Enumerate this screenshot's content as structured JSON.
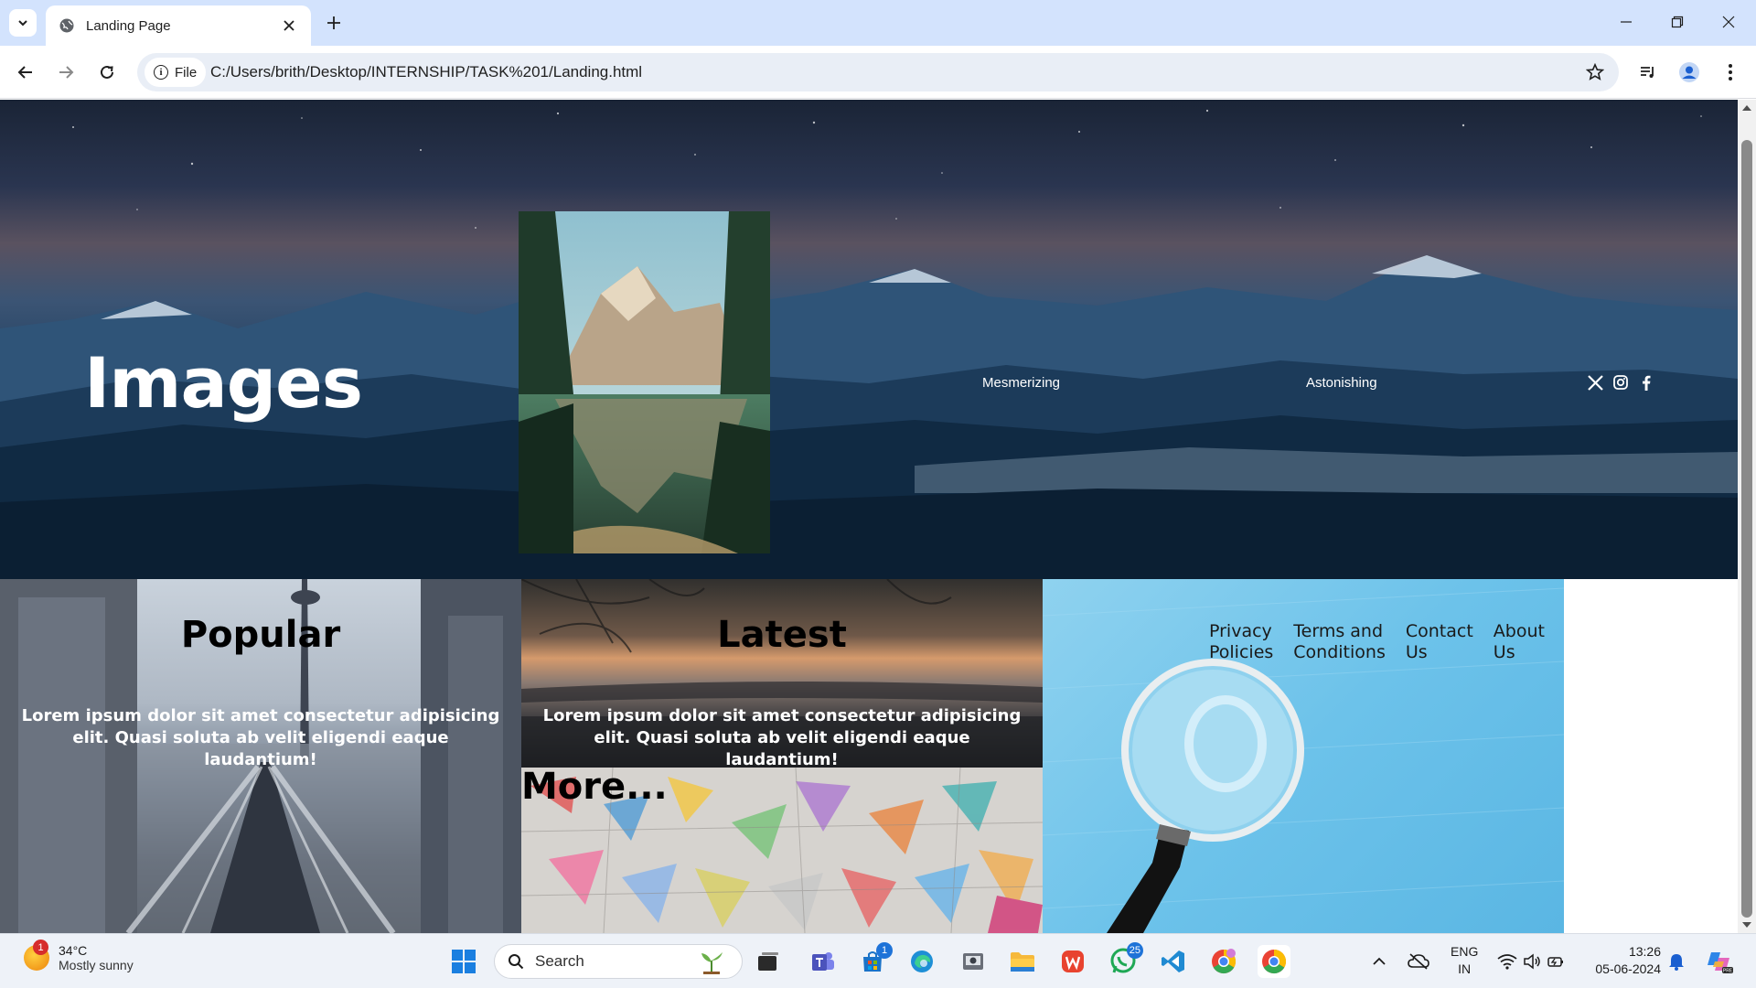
{
  "browser": {
    "tab_title": "Landing Page",
    "site_chip": "File",
    "url": "C:/Users/brith/Desktop/INTERNSHIP/TASK%201/Landing.html"
  },
  "hero": {
    "title": "Images",
    "links": [
      "Mesmerizing",
      "Astonishing"
    ],
    "social_icons": [
      "x-icon",
      "instagram-icon",
      "facebook-icon"
    ]
  },
  "cards": {
    "popular": {
      "title": "Popular",
      "text": "Lorem ipsum dolor sit amet consectetur adipisicing elit. Quasi soluta ab velit eligendi eaque laudantium!"
    },
    "latest": {
      "title": "Latest",
      "text": "Lorem ipsum dolor sit amet consectetur adipisicing elit. Quasi soluta ab velit eligendi eaque laudantium!"
    },
    "more": {
      "title": "More..."
    }
  },
  "footer": {
    "links": [
      {
        "line1": "Privacy",
        "line2": "Policies"
      },
      {
        "line1": "Terms and",
        "line2": "Conditions"
      },
      {
        "line1": "Contact",
        "line2": "Us"
      },
      {
        "line1": "About",
        "line2": "Us"
      }
    ]
  },
  "taskbar": {
    "weather_badge": "1",
    "temperature": "34°C",
    "condition": "Mostly sunny",
    "search_label": "Search",
    "store_badge": "1",
    "whatsapp_badge": "25",
    "lang_line1": "ENG",
    "lang_line2": "IN",
    "time": "13:26",
    "date": "05-06-2024"
  },
  "colors": {
    "tabstrip": "#d3e3fd",
    "footer_card": "#6cc2ea",
    "taskbar": "#eef2f8"
  }
}
